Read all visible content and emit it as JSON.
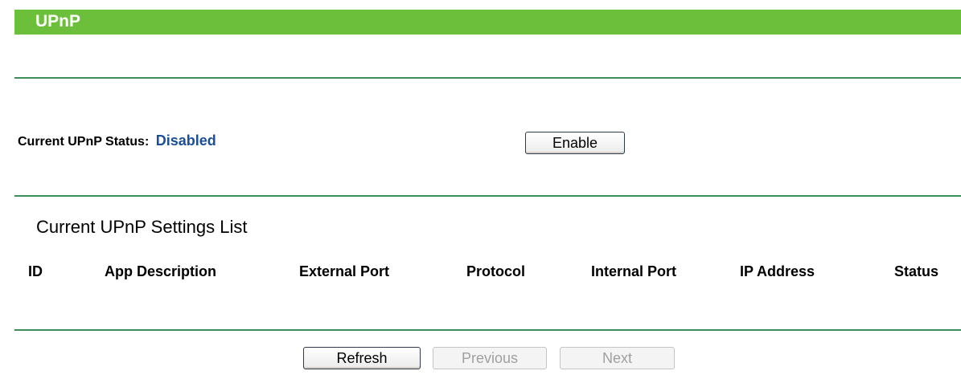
{
  "header": {
    "title": "UPnP"
  },
  "status": {
    "label": "Current UPnP Status:",
    "value": "Disabled",
    "enable_label": "Enable"
  },
  "settings_list": {
    "title": "Current UPnP Settings List",
    "columns": [
      "ID",
      "App Description",
      "External Port",
      "Protocol",
      "Internal Port",
      "IP Address",
      "Status"
    ],
    "rows": []
  },
  "pagination": {
    "refresh_label": "Refresh",
    "previous_label": "Previous",
    "next_label": "Next"
  },
  "colors": {
    "header_bar": "#6cbf3a",
    "divider": "#3d8f5a",
    "status_value": "#1b4f9c"
  }
}
